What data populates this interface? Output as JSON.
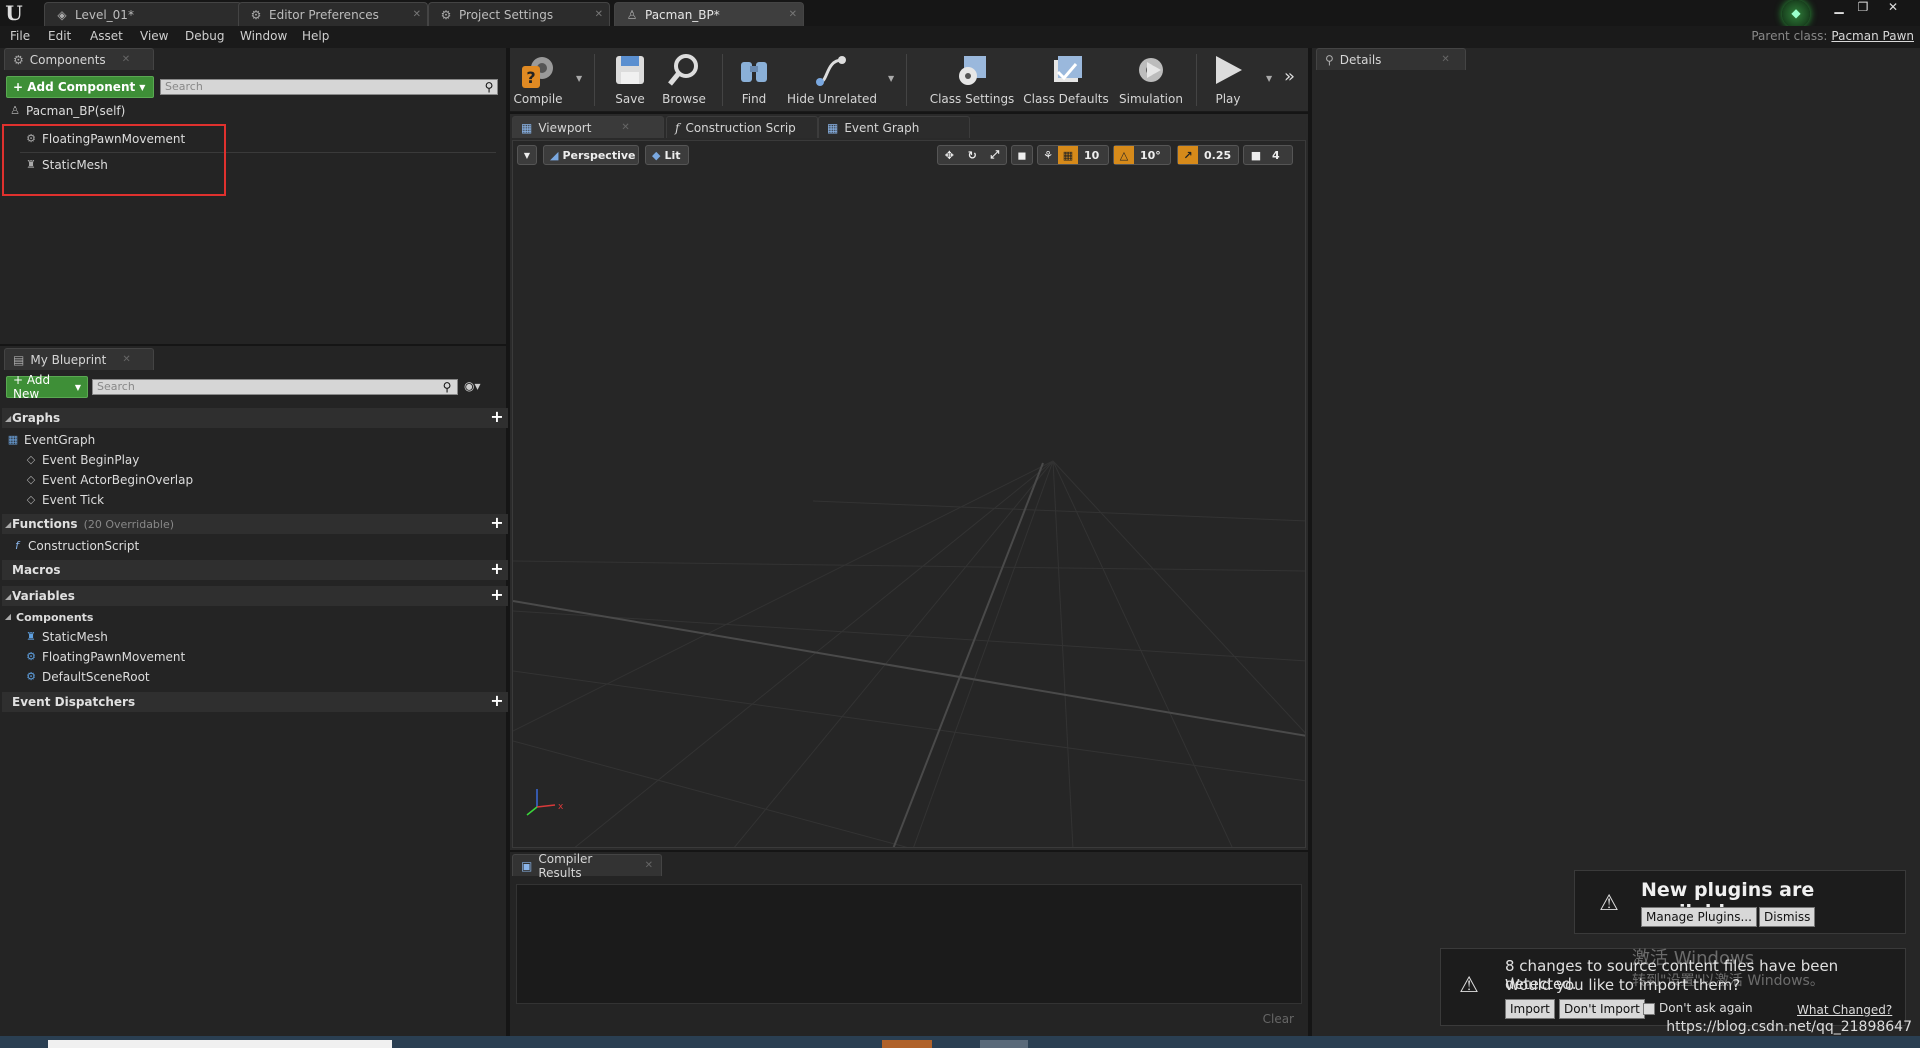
{
  "title_tabs": [
    {
      "label": "Level_01*"
    },
    {
      "label": "Editor Preferences"
    },
    {
      "label": "Project Settings"
    },
    {
      "label": "Pacman_BP*"
    }
  ],
  "menu": [
    "File",
    "Edit",
    "Asset",
    "View",
    "Debug",
    "Window",
    "Help"
  ],
  "parent_class": {
    "label": "Parent class:",
    "value": "Pacman Pawn"
  },
  "components_panel": {
    "tab": "Components",
    "add_button": "+ Add Component",
    "search_placeholder": "Search",
    "root": "Pacman_BP(self)",
    "items": [
      "FloatingPawnMovement",
      "StaticMesh"
    ]
  },
  "my_blueprint": {
    "tab": "My Blueprint",
    "add_button": "+ Add New",
    "search_placeholder": "Search",
    "graphs_label": "Graphs",
    "event_graph": "EventGraph",
    "events": [
      "Event BeginPlay",
      "Event ActorBeginOverlap",
      "Event Tick"
    ],
    "functions_label": "Functions",
    "functions_sub": "(20 Overridable)",
    "construction_script": "ConstructionScript",
    "macros_label": "Macros",
    "variables_label": "Variables",
    "components_label": "Components",
    "component_vars": [
      "StaticMesh",
      "FloatingPawnMovement",
      "DefaultSceneRoot"
    ],
    "dispatchers_label": "Event Dispatchers"
  },
  "toolbar": {
    "compile": "Compile",
    "save": "Save",
    "browse": "Browse",
    "find": "Find",
    "hide_unrelated": "Hide Unrelated",
    "class_settings": "Class Settings",
    "class_defaults": "Class Defaults",
    "simulation": "Simulation",
    "play": "Play"
  },
  "editor_tabs": [
    "Viewport",
    "Construction Scrip",
    "Event Graph"
  ],
  "viewport": {
    "perspective": "Perspective",
    "lit": "Lit",
    "grid_snap": "10",
    "rot_snap": "10°",
    "scale_snap": "0.25",
    "cam_speed": "4"
  },
  "compiler": {
    "tab": "Compiler Results",
    "clear": "Clear"
  },
  "details": {
    "tab": "Details"
  },
  "notif_plugins": {
    "title": "New plugins are available",
    "manage": "Manage Plugins...",
    "dismiss": "Dismiss"
  },
  "notif_import": {
    "line1": "8 changes to source content files have been detected.",
    "line2": "Would you like to import them?",
    "import": "Import",
    "dont_import": "Don't Import",
    "dont_ask": "Don't ask again",
    "what_changed": "What Changed?"
  },
  "overlay": {
    "win_activate": "激活 Windows",
    "win_activate_sub": "转到\"设置\"以激活 Windows。",
    "watermark": "https://blog.csdn.net/qq_21898647"
  },
  "colors": {
    "accent_green": "#3e8f37",
    "highlight_red": "#e0312e",
    "snap_orange": "#d68a1a"
  }
}
